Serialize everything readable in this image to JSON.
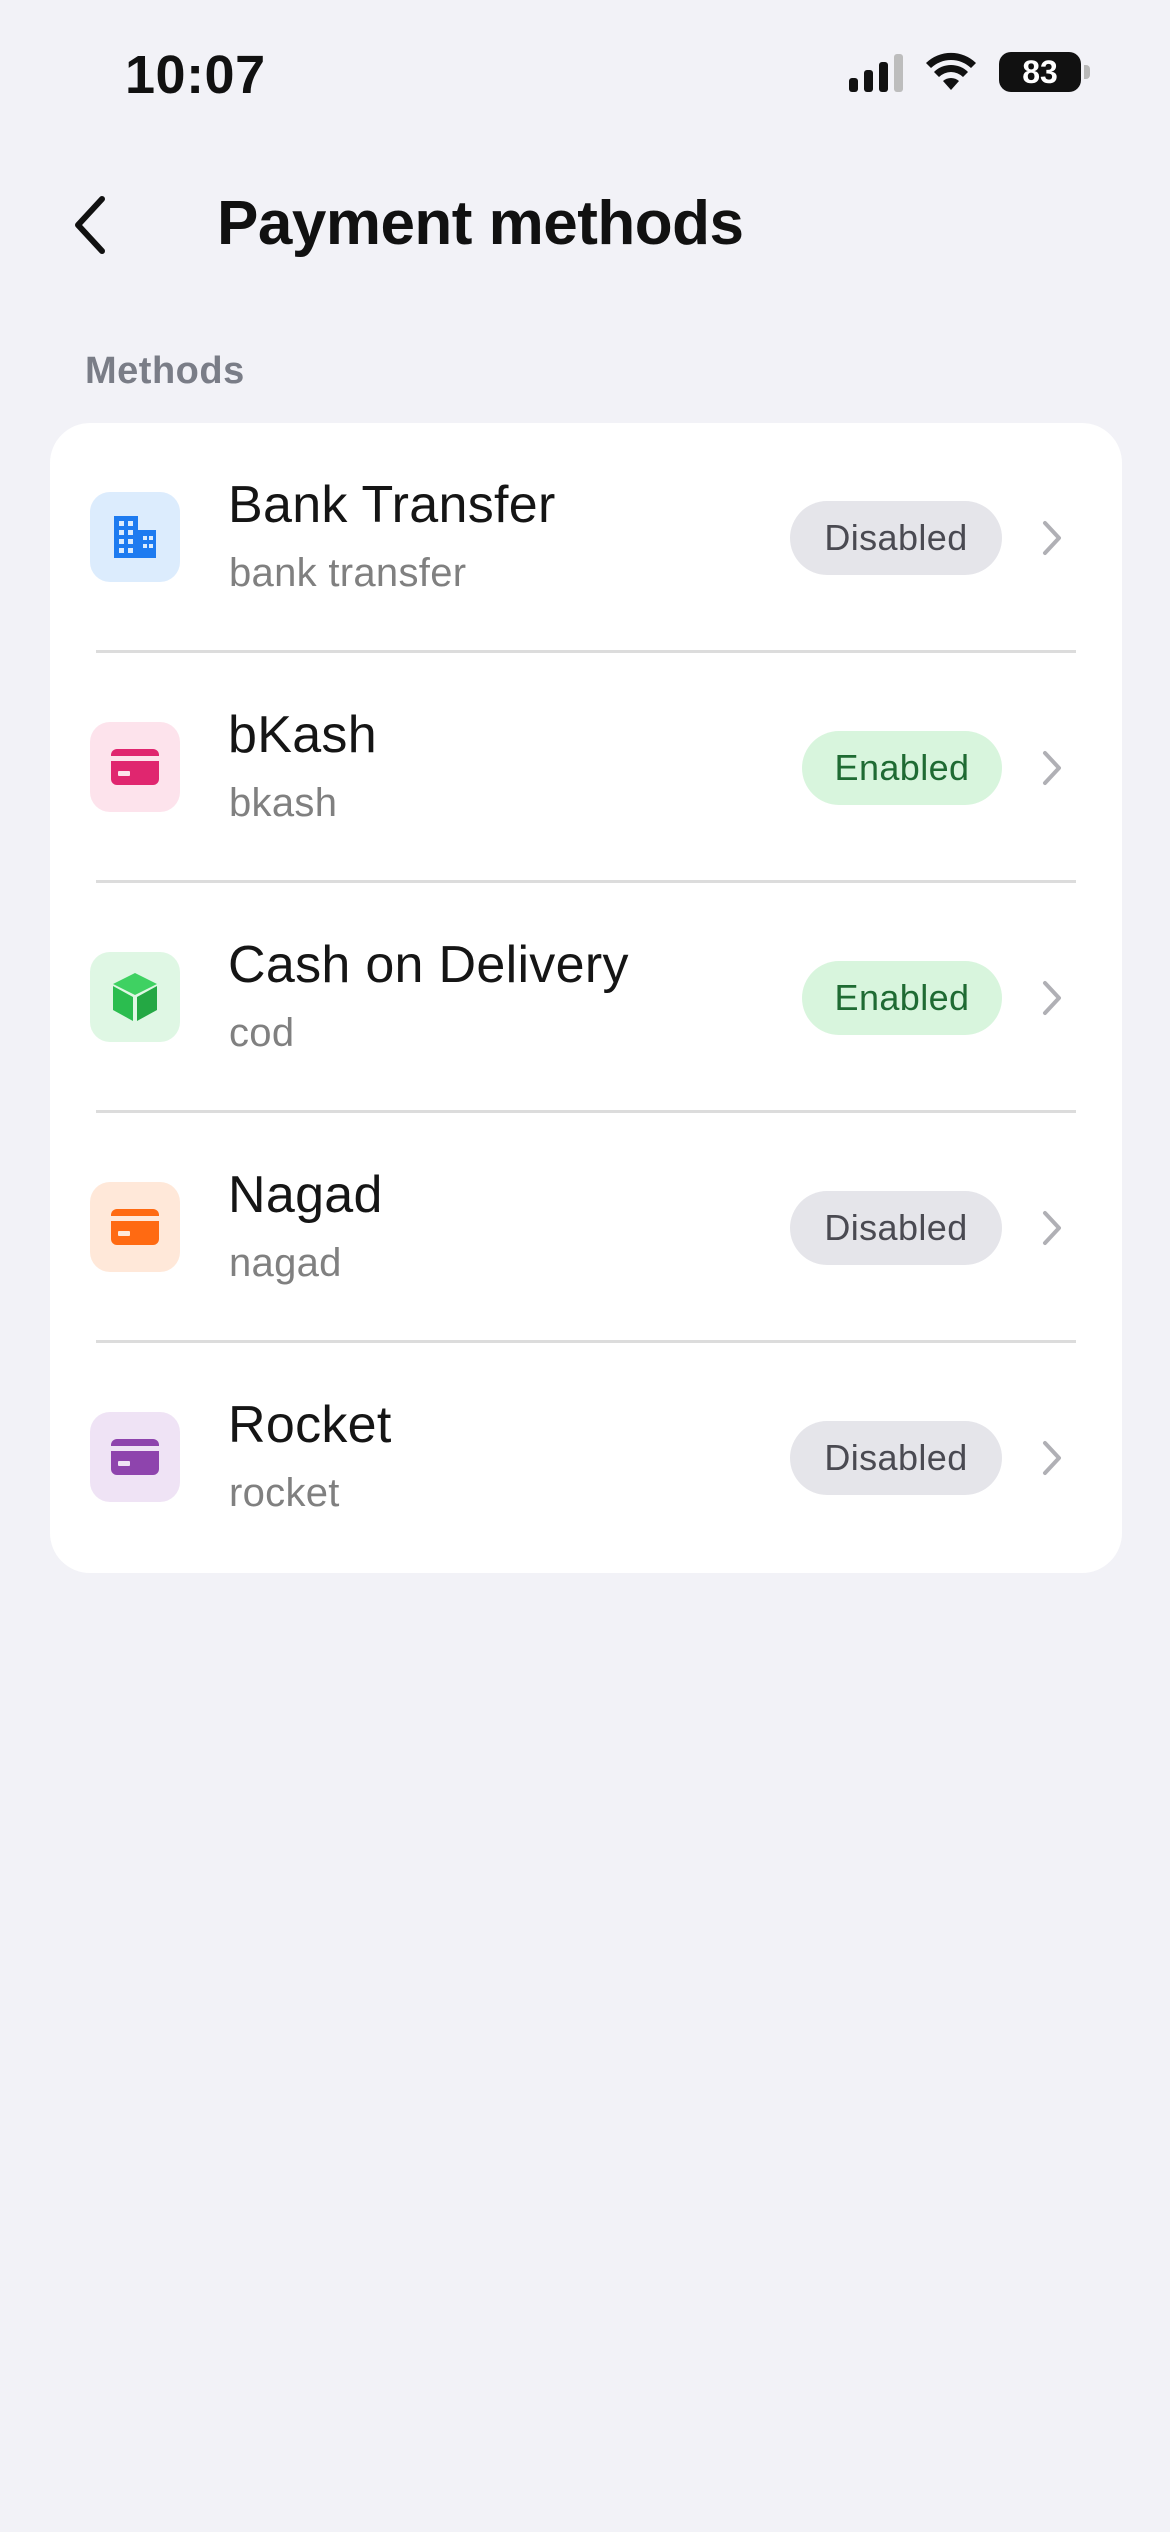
{
  "status_bar": {
    "time": "10:07",
    "battery": "83"
  },
  "header": {
    "title": "Payment methods",
    "back_icon": "chevron-left-icon"
  },
  "section": {
    "label": "Methods"
  },
  "methods": [
    {
      "title": "Bank Transfer",
      "code": "bank transfer",
      "status": "Disabled",
      "icon": "building-icon",
      "icon_color": "#1e7bf0",
      "icon_bg": "#dcecfd"
    },
    {
      "title": "bKash",
      "code": "bkash",
      "status": "Enabled",
      "icon": "card-icon",
      "icon_color": "#e0266f",
      "icon_bg": "#fde3ec"
    },
    {
      "title": "Cash on Delivery",
      "code": "cod",
      "status": "Enabled",
      "icon": "package-icon",
      "icon_color": "#2bbd4f",
      "icon_bg": "#dff7e4"
    },
    {
      "title": "Nagad",
      "code": "nagad",
      "status": "Disabled",
      "icon": "card-icon",
      "icon_color": "#ff6a12",
      "icon_bg": "#ffe8d9"
    },
    {
      "title": "Rocket",
      "code": "rocket",
      "status": "Disabled",
      "icon": "card-icon",
      "icon_color": "#8e44ad",
      "icon_bg": "#efe3f5"
    }
  ],
  "colors": {
    "background": "#f2f2f7",
    "enabled_badge_bg": "#d8f5dd",
    "enabled_badge_text": "#1f6b33",
    "disabled_badge_bg": "#e5e5ea",
    "disabled_badge_text": "#4a4a52"
  }
}
